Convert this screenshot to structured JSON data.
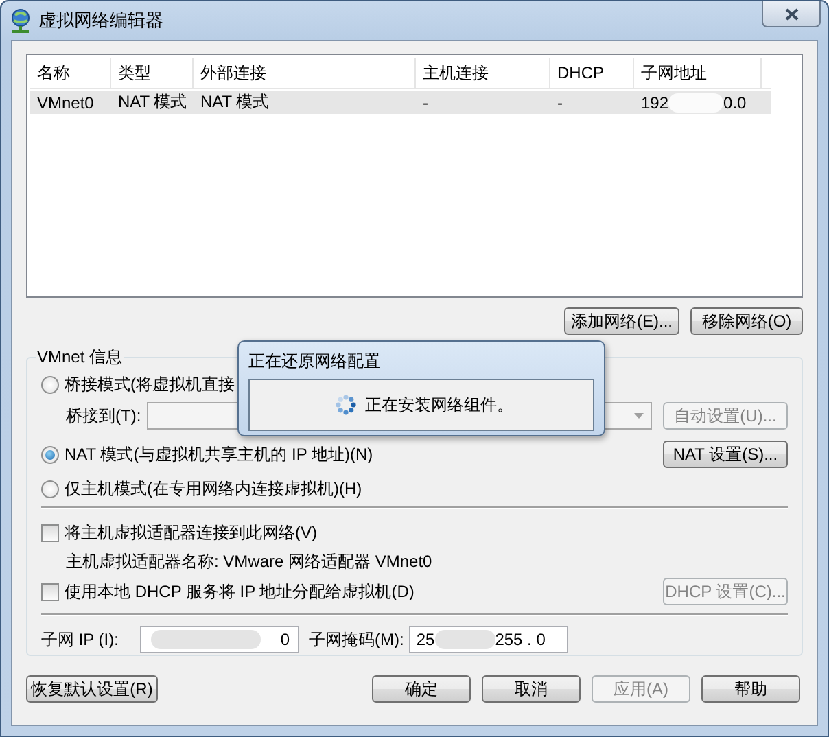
{
  "window": {
    "title": "虚拟网络编辑器"
  },
  "network_table": {
    "columns": [
      "名称",
      "类型",
      "外部连接",
      "主机连接",
      "DHCP",
      "子网地址"
    ],
    "rows": [
      {
        "selected": true,
        "cells": [
          "VMnet0",
          "NAT 模式",
          "NAT 模式",
          "-",
          "-"
        ],
        "subnet_start": "192",
        "subnet_end": "0.0"
      }
    ]
  },
  "network_buttons": [
    {
      "label": "添加网络(E)...",
      "disabled": false
    },
    {
      "label": "移除网络(O)",
      "disabled": false
    }
  ],
  "vmnet_info": {
    "title": "VMnet 信息",
    "modes": [
      {
        "label": "桥接模式(将虚拟机直接",
        "selected": false
      },
      {
        "label": "NAT 模式(与虚拟机共享主机的 IP 地址)(N)",
        "selected": true,
        "button": {
          "label": "NAT 设置(S)...",
          "disabled": false
        }
      },
      {
        "label": "仅主机模式(在专用网络内连接虚拟机)(H)",
        "selected": false
      }
    ],
    "bridge_to": {
      "label": "桥接到(T):",
      "disabled": true,
      "button": {
        "label": "自动设置(U)...",
        "disabled": true
      }
    },
    "options": [
      {
        "label": "将主机虚拟适配器连接到此网络(V)",
        "checked": false,
        "detail": "主机虚拟适配器名称: VMware 网络适配器 VMnet0"
      },
      {
        "label": "使用本地 DHCP 服务将 IP 地址分配给虚拟机(D)",
        "checked": false,
        "button": {
          "label": "DHCP 设置(C)...",
          "disabled": true
        }
      }
    ],
    "subnet_ip": {
      "label": "子网 IP (I):",
      "value_end": "0"
    },
    "subnet_mask": {
      "label": "子网掩码(M):",
      "value_start": "25",
      "value_end": "255 . 0"
    }
  },
  "footer_buttons": [
    {
      "label": "恢复默认设置(R)",
      "disabled": false
    },
    {
      "label": "确定",
      "disabled": false
    },
    {
      "label": "取消",
      "disabled": false
    },
    {
      "label": "应用(A)",
      "disabled": true
    },
    {
      "label": "帮助",
      "disabled": false
    }
  ],
  "progress_dialog": {
    "title": "正在还原网络配置",
    "message": "正在安装网络组件。"
  }
}
